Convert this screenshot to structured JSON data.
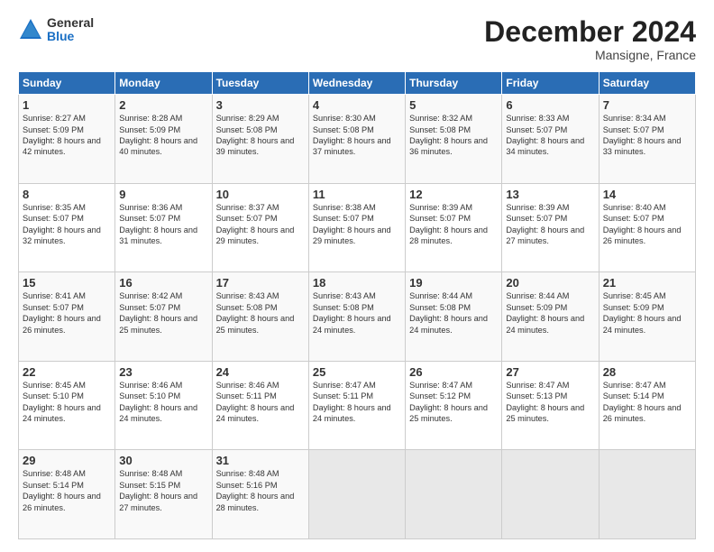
{
  "header": {
    "logo_general": "General",
    "logo_blue": "Blue",
    "month_title": "December 2024",
    "location": "Mansigne, France"
  },
  "days_of_week": [
    "Sunday",
    "Monday",
    "Tuesday",
    "Wednesday",
    "Thursday",
    "Friday",
    "Saturday"
  ],
  "weeks": [
    [
      {
        "day": "1",
        "sunrise": "Sunrise: 8:27 AM",
        "sunset": "Sunset: 5:09 PM",
        "daylight": "Daylight: 8 hours and 42 minutes."
      },
      {
        "day": "2",
        "sunrise": "Sunrise: 8:28 AM",
        "sunset": "Sunset: 5:09 PM",
        "daylight": "Daylight: 8 hours and 40 minutes."
      },
      {
        "day": "3",
        "sunrise": "Sunrise: 8:29 AM",
        "sunset": "Sunset: 5:08 PM",
        "daylight": "Daylight: 8 hours and 39 minutes."
      },
      {
        "day": "4",
        "sunrise": "Sunrise: 8:30 AM",
        "sunset": "Sunset: 5:08 PM",
        "daylight": "Daylight: 8 hours and 37 minutes."
      },
      {
        "day": "5",
        "sunrise": "Sunrise: 8:32 AM",
        "sunset": "Sunset: 5:08 PM",
        "daylight": "Daylight: 8 hours and 36 minutes."
      },
      {
        "day": "6",
        "sunrise": "Sunrise: 8:33 AM",
        "sunset": "Sunset: 5:07 PM",
        "daylight": "Daylight: 8 hours and 34 minutes."
      },
      {
        "day": "7",
        "sunrise": "Sunrise: 8:34 AM",
        "sunset": "Sunset: 5:07 PM",
        "daylight": "Daylight: 8 hours and 33 minutes."
      }
    ],
    [
      {
        "day": "8",
        "sunrise": "Sunrise: 8:35 AM",
        "sunset": "Sunset: 5:07 PM",
        "daylight": "Daylight: 8 hours and 32 minutes."
      },
      {
        "day": "9",
        "sunrise": "Sunrise: 8:36 AM",
        "sunset": "Sunset: 5:07 PM",
        "daylight": "Daylight: 8 hours and 31 minutes."
      },
      {
        "day": "10",
        "sunrise": "Sunrise: 8:37 AM",
        "sunset": "Sunset: 5:07 PM",
        "daylight": "Daylight: 8 hours and 29 minutes."
      },
      {
        "day": "11",
        "sunrise": "Sunrise: 8:38 AM",
        "sunset": "Sunset: 5:07 PM",
        "daylight": "Daylight: 8 hours and 29 minutes."
      },
      {
        "day": "12",
        "sunrise": "Sunrise: 8:39 AM",
        "sunset": "Sunset: 5:07 PM",
        "daylight": "Daylight: 8 hours and 28 minutes."
      },
      {
        "day": "13",
        "sunrise": "Sunrise: 8:39 AM",
        "sunset": "Sunset: 5:07 PM",
        "daylight": "Daylight: 8 hours and 27 minutes."
      },
      {
        "day": "14",
        "sunrise": "Sunrise: 8:40 AM",
        "sunset": "Sunset: 5:07 PM",
        "daylight": "Daylight: 8 hours and 26 minutes."
      }
    ],
    [
      {
        "day": "15",
        "sunrise": "Sunrise: 8:41 AM",
        "sunset": "Sunset: 5:07 PM",
        "daylight": "Daylight: 8 hours and 26 minutes."
      },
      {
        "day": "16",
        "sunrise": "Sunrise: 8:42 AM",
        "sunset": "Sunset: 5:07 PM",
        "daylight": "Daylight: 8 hours and 25 minutes."
      },
      {
        "day": "17",
        "sunrise": "Sunrise: 8:43 AM",
        "sunset": "Sunset: 5:08 PM",
        "daylight": "Daylight: 8 hours and 25 minutes."
      },
      {
        "day": "18",
        "sunrise": "Sunrise: 8:43 AM",
        "sunset": "Sunset: 5:08 PM",
        "daylight": "Daylight: 8 hours and 24 minutes."
      },
      {
        "day": "19",
        "sunrise": "Sunrise: 8:44 AM",
        "sunset": "Sunset: 5:08 PM",
        "daylight": "Daylight: 8 hours and 24 minutes."
      },
      {
        "day": "20",
        "sunrise": "Sunrise: 8:44 AM",
        "sunset": "Sunset: 5:09 PM",
        "daylight": "Daylight: 8 hours and 24 minutes."
      },
      {
        "day": "21",
        "sunrise": "Sunrise: 8:45 AM",
        "sunset": "Sunset: 5:09 PM",
        "daylight": "Daylight: 8 hours and 24 minutes."
      }
    ],
    [
      {
        "day": "22",
        "sunrise": "Sunrise: 8:45 AM",
        "sunset": "Sunset: 5:10 PM",
        "daylight": "Daylight: 8 hours and 24 minutes."
      },
      {
        "day": "23",
        "sunrise": "Sunrise: 8:46 AM",
        "sunset": "Sunset: 5:10 PM",
        "daylight": "Daylight: 8 hours and 24 minutes."
      },
      {
        "day": "24",
        "sunrise": "Sunrise: 8:46 AM",
        "sunset": "Sunset: 5:11 PM",
        "daylight": "Daylight: 8 hours and 24 minutes."
      },
      {
        "day": "25",
        "sunrise": "Sunrise: 8:47 AM",
        "sunset": "Sunset: 5:11 PM",
        "daylight": "Daylight: 8 hours and 24 minutes."
      },
      {
        "day": "26",
        "sunrise": "Sunrise: 8:47 AM",
        "sunset": "Sunset: 5:12 PM",
        "daylight": "Daylight: 8 hours and 25 minutes."
      },
      {
        "day": "27",
        "sunrise": "Sunrise: 8:47 AM",
        "sunset": "Sunset: 5:13 PM",
        "daylight": "Daylight: 8 hours and 25 minutes."
      },
      {
        "day": "28",
        "sunrise": "Sunrise: 8:47 AM",
        "sunset": "Sunset: 5:14 PM",
        "daylight": "Daylight: 8 hours and 26 minutes."
      }
    ],
    [
      {
        "day": "29",
        "sunrise": "Sunrise: 8:48 AM",
        "sunset": "Sunset: 5:14 PM",
        "daylight": "Daylight: 8 hours and 26 minutes."
      },
      {
        "day": "30",
        "sunrise": "Sunrise: 8:48 AM",
        "sunset": "Sunset: 5:15 PM",
        "daylight": "Daylight: 8 hours and 27 minutes."
      },
      {
        "day": "31",
        "sunrise": "Sunrise: 8:48 AM",
        "sunset": "Sunset: 5:16 PM",
        "daylight": "Daylight: 8 hours and 28 minutes."
      },
      null,
      null,
      null,
      null
    ]
  ]
}
